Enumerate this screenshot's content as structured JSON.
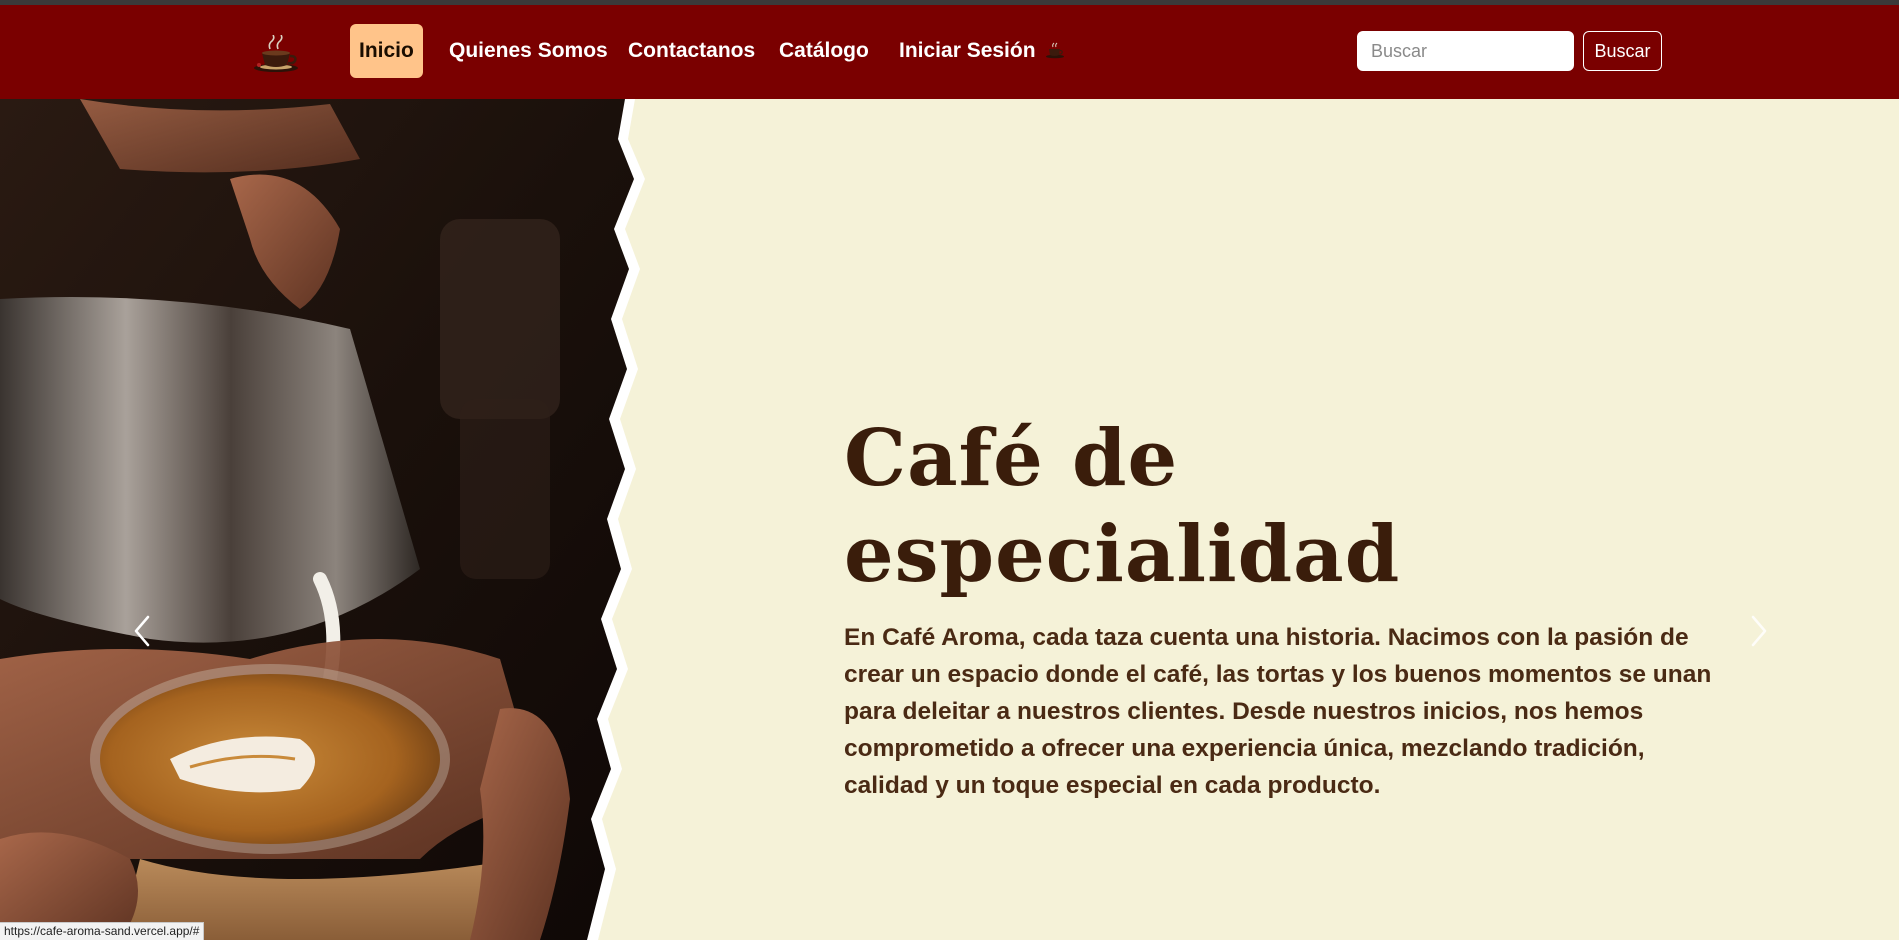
{
  "brand": {
    "logo_icon": "coffee-cup-logo-icon",
    "accent": "#7a0000",
    "active_bg": "#ffc48a"
  },
  "nav": {
    "items": [
      {
        "label": "Inicio",
        "active": true
      },
      {
        "label": "Quienes Somos"
      },
      {
        "label": "Contactanos"
      },
      {
        "label": "Catálogo"
      },
      {
        "label": "Iniciar Sesión",
        "icon": "coffee-cup-icon"
      }
    ]
  },
  "search": {
    "placeholder": "Buscar",
    "value": "",
    "button_label": "Buscar"
  },
  "hero": {
    "title_line1": "Café de",
    "title_line2": "especialidad",
    "text": "En Café Aroma, cada taza cuenta una historia. Nacimos con la pasión de crear un espacio donde el café, las tortas y los buenos momentos se unan para deleitar a nuestros clientes. Desde nuestros inicios, nos hemos comprometido a ofrecer una experiencia única, mezclando tradición, calidad y un toque especial en cada producto.",
    "image": "latte-art-pour-photo",
    "prev_icon": "chevron-left-icon",
    "next_icon": "chevron-right-icon",
    "bg": "#f5f2d8",
    "title_color": "#3a1d0b"
  },
  "status_bar": {
    "url": "https://cafe-aroma-sand.vercel.app/#"
  }
}
